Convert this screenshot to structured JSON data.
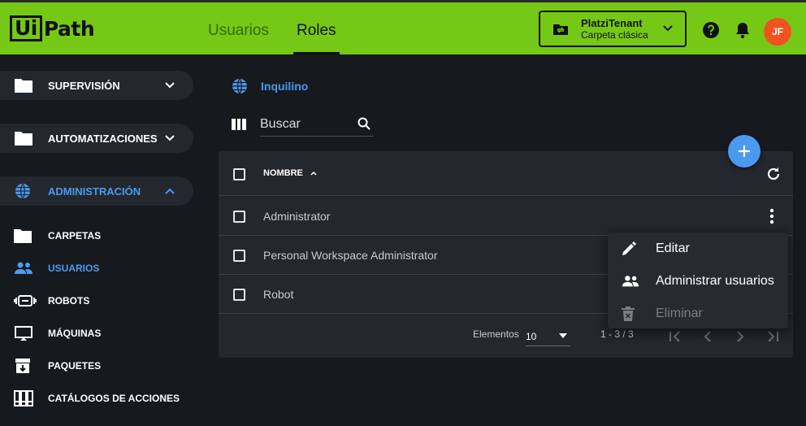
{
  "header": {
    "logo_box": "Ui",
    "logo_rest": "Path",
    "tabs": [
      "Usuarios",
      "Roles"
    ],
    "active_tab": "Roles",
    "tenant_name": "PlatziTenant",
    "tenant_folder": "Carpeta clásica",
    "avatar_initials": "JF"
  },
  "sidebar": {
    "sections": [
      {
        "label": "SUPERVISIÓN",
        "icon": "folder-icon",
        "expanded": false
      },
      {
        "label": "AUTOMATIZACIONES",
        "icon": "folder-icon",
        "expanded": false
      },
      {
        "label": "ADMINISTRACIÓN",
        "icon": "globe-icon",
        "expanded": true
      }
    ],
    "items": [
      {
        "label": "CARPETAS",
        "icon": "folder-icon"
      },
      {
        "label": "USUARIOS",
        "icon": "people-icon",
        "active": true
      },
      {
        "label": "ROBOTS",
        "icon": "robot-icon"
      },
      {
        "label": "MÁQUINAS",
        "icon": "monitor-icon"
      },
      {
        "label": "PAQUETES",
        "icon": "package-icon"
      },
      {
        "label": "CATÁLOGOS DE ACCIONES",
        "icon": "catalog-icon"
      }
    ]
  },
  "main": {
    "scope_label": "Inquilino",
    "search_placeholder": "Buscar",
    "table": {
      "column_header": "NOMBRE",
      "rows": [
        "Administrator",
        "Personal Workspace Administrator",
        "Robot"
      ]
    },
    "footer": {
      "items_label": "Elementos",
      "page_size": "10",
      "range": "1 - 3 / 3"
    }
  },
  "context_menu": {
    "items": [
      {
        "label": "Editar",
        "icon": "pencil-icon",
        "disabled": false
      },
      {
        "label": "Administrar usuarios",
        "icon": "people-icon",
        "disabled": false
      },
      {
        "label": "Eliminar",
        "icon": "trash-icon",
        "disabled": true
      }
    ]
  },
  "colors": {
    "brand_green": "#76c816",
    "accent_blue": "#4a9af0",
    "avatar": "#f1521f",
    "background": "#16191e",
    "card": "#23272e"
  }
}
